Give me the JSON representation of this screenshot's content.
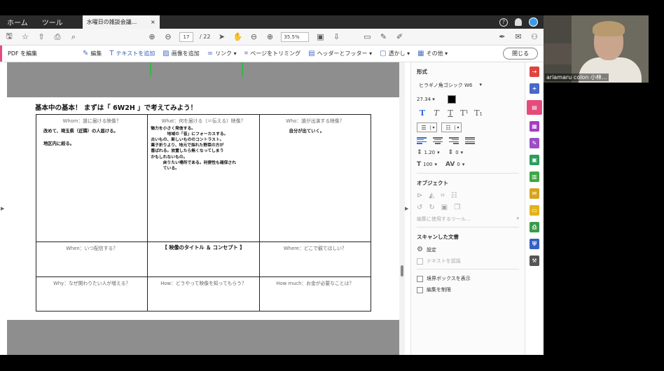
{
  "menu": {
    "home": "ホーム",
    "tools": "ツール",
    "doc_tab": "水曜日の雑談会議..."
  },
  "toolbar": {
    "page_current": "17",
    "page_total": "/ 22",
    "zoom": "35.5%"
  },
  "editbar": {
    "title": "PDF を編集",
    "tools": [
      "編集",
      "テキストを追加",
      "画像を追加",
      "リンク ▾",
      "ページをトリミング",
      "ヘッダーとフッター ▾",
      "透かし ▾",
      "その他 ▾"
    ],
    "close": "閉じる"
  },
  "document": {
    "heading": "基本中の基本！ まずは「 6W2H 」で考えてみよう！",
    "cells": {
      "whom": {
        "label": "Whom：誰に届ける映像？",
        "note": "改めて、埼玉県（近隣）の人届ける。\n\n地区内に絞る。"
      },
      "what": {
        "label": "What：何を届ける（＝伝える）映像？",
        "note": "魅力を小さく発信する。\n　　　　地域の「音」にフォーカスする。\n古いもの、新しいもののコントラスト。\n菓子折りより、地元で採れた野菜の方が\n喜ばれる。放置したら無くなってしまう\nかもしれないもの。\n　　　戻りたい場所である。利便性も確保され\n　　　ている。"
      },
      "who": {
        "label": "Who：誰が出演する映像？",
        "note": "自分が出ていく。"
      },
      "when": {
        "label": "When：いつ配信する？"
      },
      "title": {
        "label": "【 映像のタイトル ＆ コンセプト 】"
      },
      "where": {
        "label": "Where：どこで観てほしい？"
      },
      "why": {
        "label": "Why：なぜ関わりたい人が増える？"
      },
      "how": {
        "label": "How：どうやって映像を知ってもらう？"
      },
      "howmuch": {
        "label": "How much：お金が必要なことは？"
      }
    }
  },
  "panel": {
    "format_title": "形式",
    "font": "ヒラギノ角ゴシック W6",
    "font_size": "27.34",
    "line_spacing": "1.20",
    "para_spacing": "0",
    "h_scale": "100",
    "char_spacing": "0",
    "object_title": "オブジェクト",
    "edit_using": "編集に使用するツール...",
    "scanned_title": "スキャンした文書",
    "settings": "設定",
    "recognize_text": "テキストを認識",
    "show_bbox": "境界ボックスを表示",
    "restrict_edit": "編集を制限"
  },
  "video": {
    "name": "ariamaru colon 小林..."
  },
  "colors": {
    "accent": "#e34c7b",
    "blue": "#2f6bd6",
    "topbar": "#2b2b2b"
  }
}
